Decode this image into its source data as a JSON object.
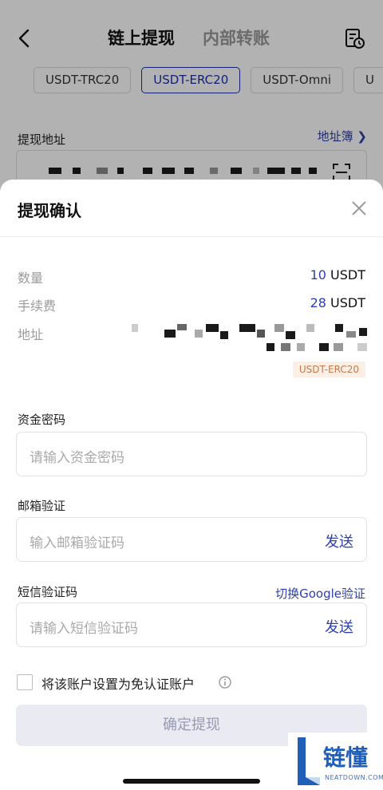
{
  "header": {
    "tab_onchain": "链上提现",
    "tab_internal": "内部转账"
  },
  "chips": [
    "USDT-TRC20",
    "USDT-ERC20",
    "USDT-Omni",
    "U"
  ],
  "address_section": {
    "label": "提现地址",
    "book_link": "地址簿 ❯"
  },
  "sheet": {
    "title": "提现确认",
    "quantity_label": "数量",
    "quantity_num": "10",
    "quantity_unit": " USDT",
    "fee_label": "手续费",
    "fee_num": "28",
    "fee_unit": " USDT",
    "address_label": "地址",
    "network_tag": "USDT-ERC20",
    "fund_password": {
      "label": "资金密码",
      "placeholder": "请输入资金密码"
    },
    "email_verify": {
      "label": "邮箱验证",
      "placeholder": "输入邮箱验证码",
      "send": "发送"
    },
    "sms_verify": {
      "label": "短信验证码",
      "switch_link": "切换Google验证",
      "placeholder": "请输入短信验证码",
      "send": "发送"
    },
    "exempt_checkbox_label": "将该账户设置为免认证账户",
    "confirm_button": "确定提现"
  },
  "watermark": {
    "text": "链懂",
    "sub": "NEATDOWN.COM"
  },
  "colors": {
    "accent": "#2f3fa8",
    "tag_bg": "#fbefe6",
    "tag_text": "#c47a4a",
    "disabled_button": "#eaeaf2"
  }
}
